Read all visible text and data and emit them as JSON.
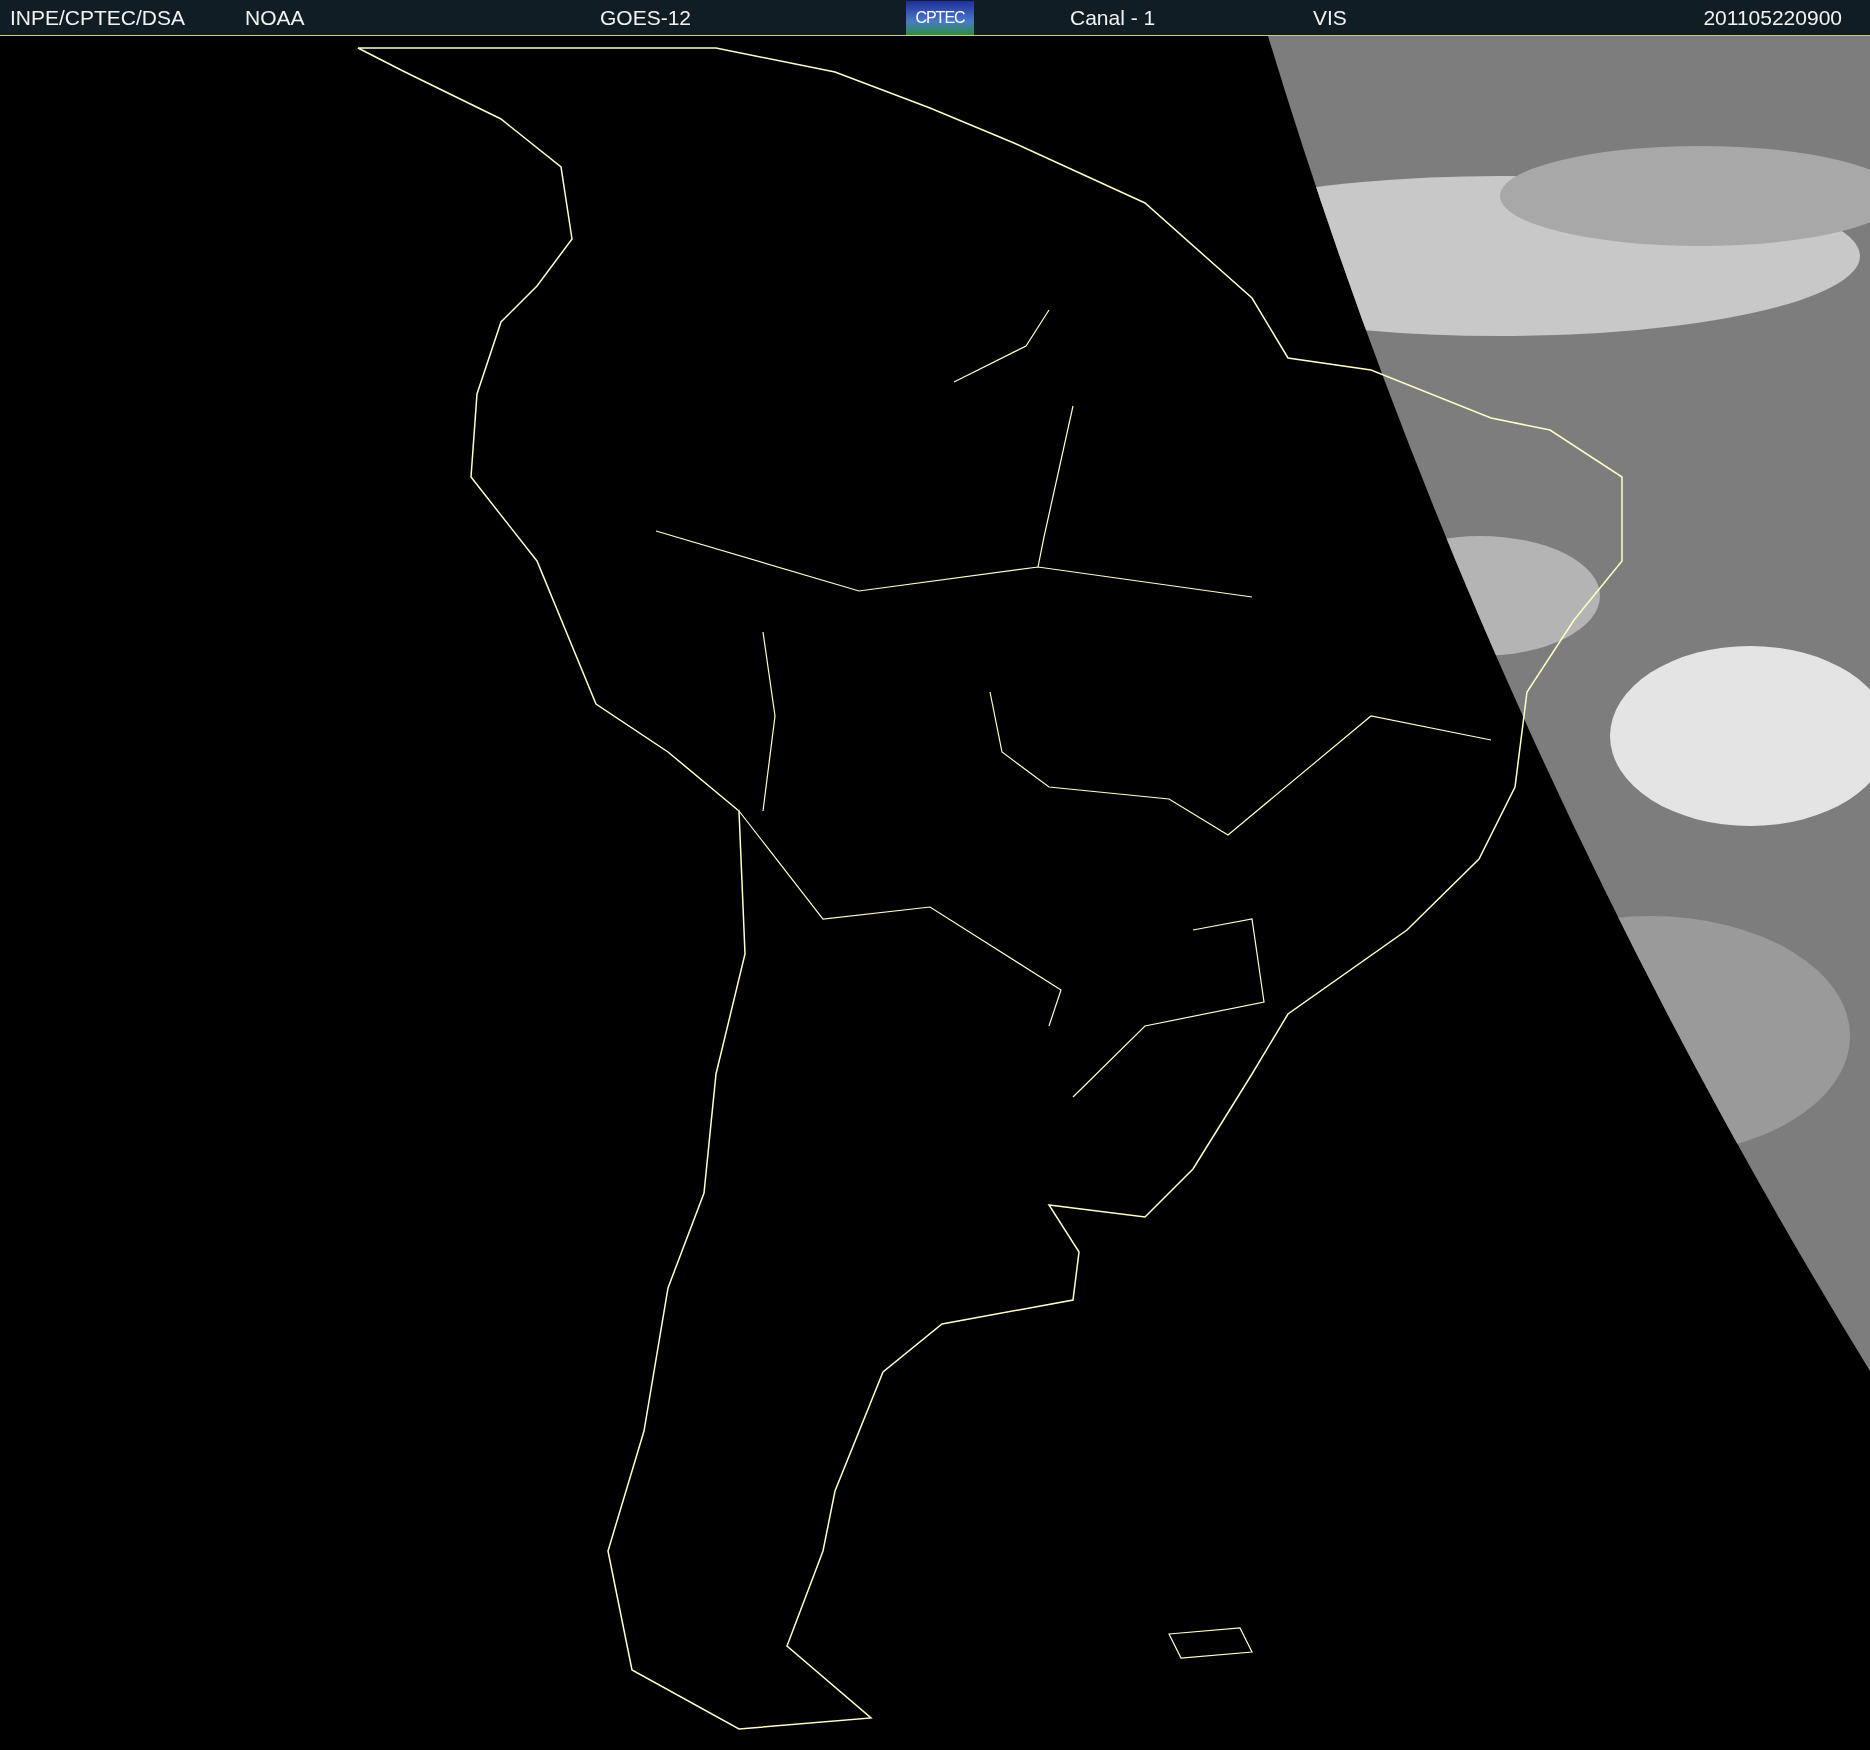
{
  "header": {
    "source": "INPE/CPTEC/DSA",
    "agency": "NOAA",
    "satellite": "GOES-12",
    "logo": {
      "text": "CPTEC"
    },
    "channel": "Canal - 1",
    "band": "VIS",
    "timestamp": "201105220900"
  }
}
